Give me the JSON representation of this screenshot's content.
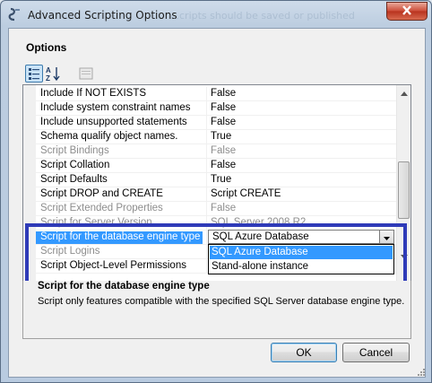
{
  "window": {
    "title": "Advanced Scripting Options",
    "background_title_fragment": "…cripts should be saved or published"
  },
  "options_heading": "Options",
  "toolbar": {
    "categorized_icon": "categorized-view-icon",
    "alphabetical_icon": "sort-alphabetical-icon",
    "property_pages_icon": "property-pages-icon"
  },
  "properties": [
    {
      "name": "Include If NOT EXISTS",
      "value": "False",
      "enabled": true
    },
    {
      "name": "Include system constraint names",
      "value": "False",
      "enabled": true
    },
    {
      "name": "Include unsupported statements",
      "value": "False",
      "enabled": true
    },
    {
      "name": "Schema qualify object names.",
      "value": "True",
      "enabled": true
    },
    {
      "name": "Script Bindings",
      "value": "False",
      "enabled": false
    },
    {
      "name": "Script Collation",
      "value": "False",
      "enabled": true
    },
    {
      "name": "Script Defaults",
      "value": "True",
      "enabled": true
    },
    {
      "name": "Script DROP and CREATE",
      "value": "Script CREATE",
      "enabled": true
    },
    {
      "name": "Script Extended Properties",
      "value": "False",
      "enabled": false
    },
    {
      "name": "Script for Server Version",
      "value": "SQL Server 2008 R2",
      "enabled": false
    },
    {
      "name": "Script for the database engine type",
      "value": "SQL Azure Database",
      "enabled": true,
      "selected": true
    },
    {
      "name": "Script Logins",
      "value": "",
      "enabled": false
    },
    {
      "name": "Script Object-Level Permissions",
      "value": "",
      "enabled": true
    }
  ],
  "combo": {
    "value": "SQL Azure Database",
    "options": [
      "SQL Azure Database",
      "Stand-alone instance"
    ],
    "highlighted_option": "SQL Azure Database"
  },
  "description": {
    "title": "Script for the database engine type",
    "text": "Script only features compatible with the specified SQL Server database engine type."
  },
  "buttons": {
    "ok": "OK",
    "cancel": "Cancel"
  },
  "colors": {
    "selection": "#3399ff",
    "annotation_border": "#2f3bb8",
    "disabled_text": "#8d8d8d"
  }
}
